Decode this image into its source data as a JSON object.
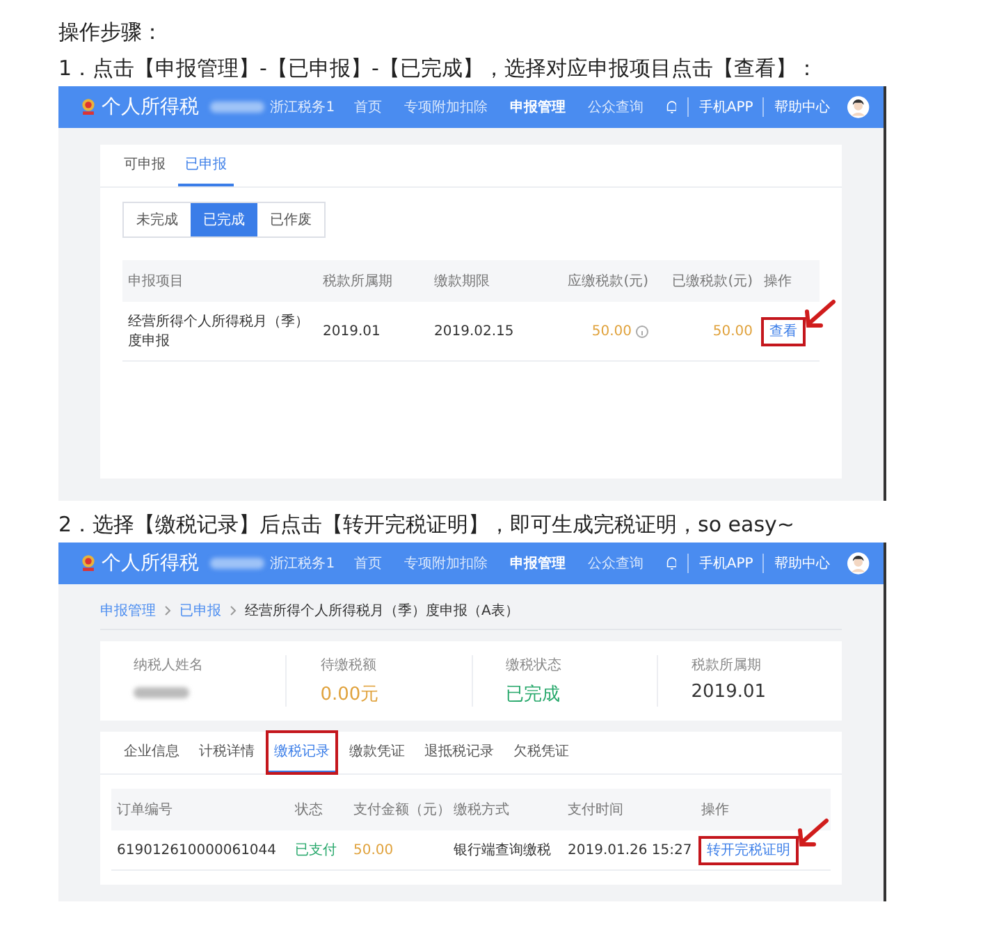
{
  "heading": "操作步骤：",
  "steps": [
    {
      "text": "1．点击【申报管理】-【已申报】-【已完成】，选择对应申报项目点击【查看】：",
      "screen": {
        "kind": "list",
        "header": {
          "logo_text": "个人所得税",
          "region": "浙江税务1",
          "nav": [
            {
              "label": "首页",
              "selected": false
            },
            {
              "label": "专项附加扣除",
              "selected": false
            },
            {
              "label": "申报管理",
              "selected": true
            },
            {
              "label": "公众查询",
              "selected": false
            }
          ],
          "links": [
            "手机APP",
            "帮助中心"
          ]
        },
        "tabs": [
          {
            "label": "可申报",
            "selected": false
          },
          {
            "label": "已申报",
            "selected": true
          }
        ],
        "filters": [
          {
            "label": "未完成",
            "selected": false
          },
          {
            "label": "已完成",
            "selected": true
          },
          {
            "label": "已作废",
            "selected": false
          }
        ],
        "table": {
          "columns": [
            "申报项目",
            "税款所属期",
            "缴款期限",
            "应缴税款(元)",
            "已缴税款(元)",
            "操作"
          ],
          "rows": [
            {
              "cells": [
                {
                  "kind": "text",
                  "text": "经营所得个人所得税月（季）度申报"
                },
                {
                  "kind": "text",
                  "text": "2019.01"
                },
                {
                  "kind": "text",
                  "text": "2019.02.15"
                },
                {
                  "kind": "amount_info",
                  "text": "50.00"
                },
                {
                  "kind": "amount",
                  "text": "50.00"
                },
                {
                  "kind": "action",
                  "text": "查看",
                  "highlighted": true
                }
              ]
            }
          ]
        }
      }
    },
    {
      "text": "2．选择【缴税记录】后点击【转开完税证明】，即可生成完税证明，so easy~",
      "screen": {
        "kind": "detail",
        "header": {
          "logo_text": "个人所得税",
          "region": "浙江税务1",
          "nav": [
            {
              "label": "首页",
              "selected": false
            },
            {
              "label": "专项附加扣除",
              "selected": false
            },
            {
              "label": "申报管理",
              "selected": true
            },
            {
              "label": "公众查询",
              "selected": false
            }
          ],
          "links": [
            "手机APP",
            "帮助中心"
          ]
        },
        "breadcrumb": [
          "申报管理",
          "已申报",
          "经营所得个人所得税月（季）度申报（A表）"
        ],
        "summary": [
          {
            "label": "纳税人姓名",
            "kind": "redacted"
          },
          {
            "label": "待缴税额",
            "kind": "amount",
            "value": "0.00元"
          },
          {
            "label": "缴税状态",
            "kind": "status",
            "value": "已完成"
          },
          {
            "label": "税款所属期",
            "kind": "text",
            "value": "2019.01"
          }
        ],
        "tabs": [
          {
            "label": "企业信息",
            "selected": false,
            "highlighted": false
          },
          {
            "label": "计税详情",
            "selected": false,
            "highlighted": false
          },
          {
            "label": "缴税记录",
            "selected": true,
            "highlighted": true
          },
          {
            "label": "缴款凭证",
            "selected": false,
            "highlighted": false
          },
          {
            "label": "退抵税记录",
            "selected": false,
            "highlighted": false
          },
          {
            "label": "欠税凭证",
            "selected": false,
            "highlighted": false
          }
        ],
        "table": {
          "columns": [
            "订单编号",
            "状态",
            "支付金额（元）",
            "缴税方式",
            "支付时间",
            "操作"
          ],
          "rows": [
            {
              "cells": [
                {
                  "kind": "text",
                  "text": "619012610000061044"
                },
                {
                  "kind": "status",
                  "text": "已支付"
                },
                {
                  "kind": "amount",
                  "text": "50.00"
                },
                {
                  "kind": "text",
                  "text": "银行端查询缴税"
                },
                {
                  "kind": "text",
                  "text": "2019.01.26 15:27"
                },
                {
                  "kind": "action",
                  "text": "转开完税证明",
                  "highlighted": true
                }
              ]
            }
          ]
        }
      }
    }
  ]
}
